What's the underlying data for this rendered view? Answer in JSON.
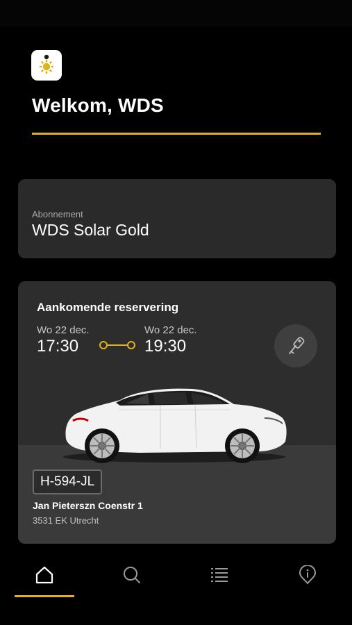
{
  "greeting": {
    "text": "Welkom, WDS"
  },
  "subscription": {
    "label": "Abonnement",
    "value": "WDS Solar Gold"
  },
  "reservation": {
    "title": "Aankomende reservering",
    "start": {
      "date": "Wo 22 dec.",
      "time": "17:30"
    },
    "end": {
      "date": "Wo 22 dec.",
      "time": "19:30"
    },
    "key_icon": "car-key-icon",
    "car_image": "white-sedan",
    "plate": "H-594-JL",
    "address_street": "Jan Pieterszn Coenstr 1",
    "address_city": "3531 EK Utrecht"
  },
  "nav": {
    "items": [
      {
        "icon": "home-icon",
        "active": true
      },
      {
        "icon": "search-icon",
        "active": false
      },
      {
        "icon": "list-icon",
        "active": false
      },
      {
        "icon": "info-pin-icon",
        "active": false
      }
    ]
  },
  "colors": {
    "accent": "#e2b21b",
    "background": "#000000",
    "card": "#2a2a2a"
  }
}
